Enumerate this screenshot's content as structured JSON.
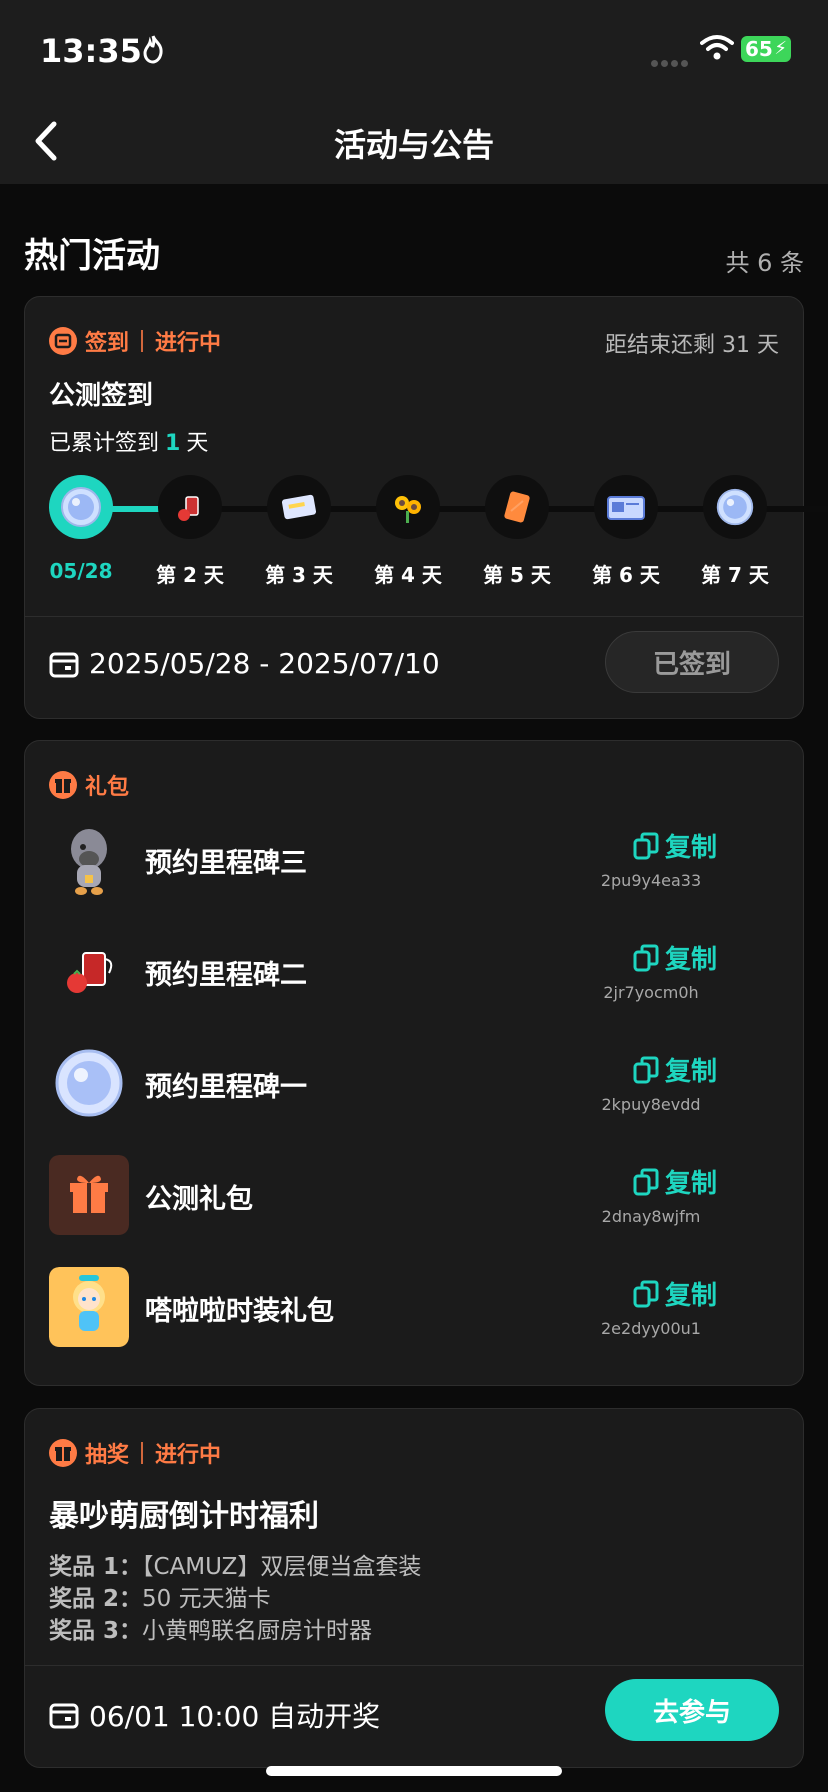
{
  "status": {
    "time": "13:35",
    "battery": "65"
  },
  "nav": {
    "title": "活动与公告"
  },
  "section": {
    "title": "热门活动",
    "count": "共 6 条"
  },
  "checkin_card": {
    "tag": "签到",
    "status": "进行中",
    "remaining": "距结束还剩 31 天",
    "title": "公测签到",
    "signed_prefix": "已累计签到",
    "signed_count": "1",
    "signed_suffix": "天",
    "days": [
      {
        "label": "05/28",
        "icon": "plate-icon",
        "active": true
      },
      {
        "label": "第 2 天",
        "icon": "juice-icon"
      },
      {
        "label": "第 3 天",
        "icon": "card-icon"
      },
      {
        "label": "第 4 天",
        "icon": "sunflower-icon"
      },
      {
        "label": "第 5 天",
        "icon": "book-icon"
      },
      {
        "label": "第 6 天",
        "icon": "badge-icon"
      },
      {
        "label": "第 7 天",
        "icon": "plate-icon"
      }
    ],
    "date_range": "2025/05/28 - 2025/07/10",
    "button": "已签到"
  },
  "gift_card": {
    "tag": "礼包",
    "items": [
      {
        "name": "预约里程碑三",
        "copy": "复制",
        "code": "2pu9y4ea33",
        "icon": "mascot-icon"
      },
      {
        "name": "预约里程碑二",
        "copy": "复制",
        "code": "2jr7yocm0h",
        "icon": "juice-icon"
      },
      {
        "name": "预约里程碑一",
        "copy": "复制",
        "code": "2kpuy8evdd",
        "icon": "plate-icon"
      },
      {
        "name": "公测礼包",
        "copy": "复制",
        "code": "2dnay8wjfm",
        "icon": "gift-icon"
      },
      {
        "name": "嗒啦啦时装礼包",
        "copy": "复制",
        "code": "2e2dyy00u1",
        "icon": "character-icon"
      }
    ]
  },
  "lottery_card": {
    "tag": "抽奖",
    "status": "进行中",
    "title": "暴吵萌厨倒计时福利",
    "prizes": [
      {
        "label": "奖品 1：",
        "text": "【CAMUZ】双层便当盒套装"
      },
      {
        "label": "奖品 2：",
        "text": "50 元天猫卡"
      },
      {
        "label": "奖品 3：",
        "text": "小黄鸭联名厨房计时器"
      }
    ],
    "draw_time": "06/01 10:00 自动开奖",
    "button": "去参与"
  },
  "colors": {
    "accent": "#1ed6c0",
    "tag": "#ff7b45",
    "background": "#0b0b0b",
    "card": "#1b1b1b"
  }
}
